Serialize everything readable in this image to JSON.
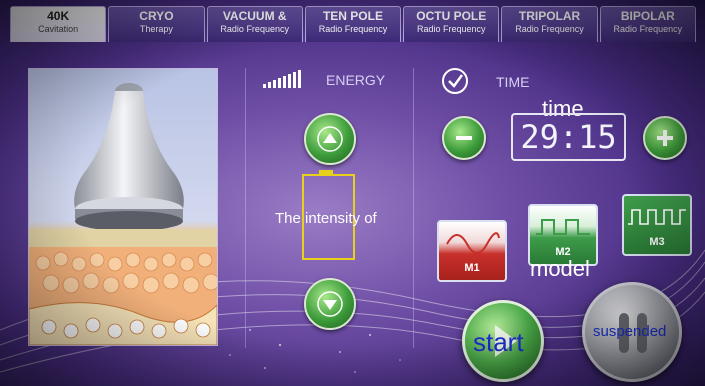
{
  "tabs": [
    {
      "title": "40K",
      "subtitle": "Cavitation",
      "active": true
    },
    {
      "title": "CRYO",
      "subtitle": "Therapy",
      "active": false
    },
    {
      "title": "VACUUM &",
      "subtitle": "Radio Frequency",
      "active": false
    },
    {
      "title": "TEN POLE",
      "subtitle": "Radio Frequency",
      "active": false
    },
    {
      "title": "OCTU POLE",
      "subtitle": "Radio Frequency",
      "active": false
    },
    {
      "title": "TRIPOLAR",
      "subtitle": "Radio Frequency",
      "active": false
    },
    {
      "title": "BIPOLAR",
      "subtitle": "Radio Frequency",
      "active": false
    }
  ],
  "energy": {
    "label": "ENERGY",
    "intensity_label": "The intensity of",
    "icons": {
      "up": "up-arrow-icon",
      "down": "down-arrow-icon",
      "battery": "battery-icon"
    }
  },
  "time": {
    "label": "TIME",
    "title": "time",
    "value": "29:15",
    "icons": {
      "minus": "minus-icon",
      "plus": "plus-icon",
      "check": "check-circle-icon"
    }
  },
  "modes": {
    "label": "model",
    "items": [
      {
        "label": "M1",
        "color": "#c8302b",
        "icon": "sine-wave-icon"
      },
      {
        "label": "M2",
        "color": "#3d9c4a",
        "icon": "square-wave-icon"
      },
      {
        "label": "M3",
        "color": "#3d9c4a",
        "icon": "square-wave-icon"
      }
    ]
  },
  "controls": {
    "start_label": "start",
    "suspend_label": "suspended",
    "icons": {
      "start": "play-icon",
      "suspend": "pause-icon"
    }
  },
  "colors": {
    "accent_green": "#3d9c3a",
    "battery_yellow": "#e8d11a",
    "label_blue": "#1a2fd0"
  }
}
